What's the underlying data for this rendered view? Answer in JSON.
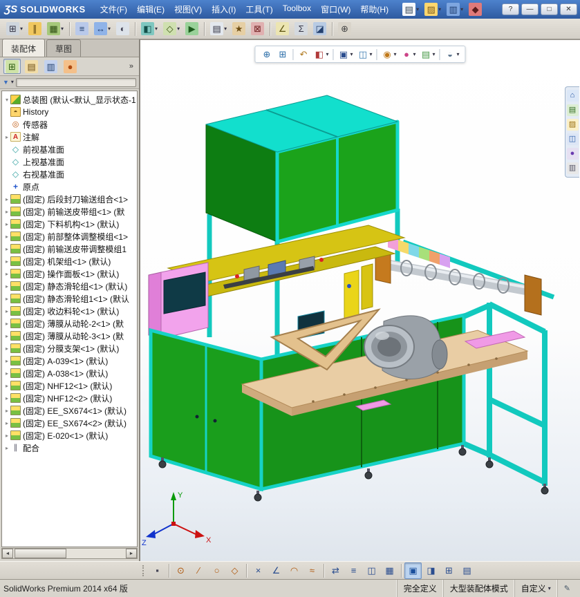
{
  "glyphs": {
    "caret_down": "▾",
    "caret_right": "▸",
    "scroll_left": "◄",
    "scroll_right": "►"
  },
  "titlebar": {
    "logo_mark": "ƷS",
    "brand": "SOLIDWORKS",
    "menus": [
      {
        "id": "file",
        "label": "文件(F)"
      },
      {
        "id": "edit",
        "label": "编辑(E)"
      },
      {
        "id": "view",
        "label": "视图(V)"
      },
      {
        "id": "insert",
        "label": "插入(I)"
      },
      {
        "id": "tools",
        "label": "工具(T)"
      },
      {
        "id": "toolbox",
        "label": "Toolbox"
      },
      {
        "id": "window",
        "label": "窗口(W)"
      },
      {
        "id": "help",
        "label": "帮助(H)"
      }
    ],
    "quick_icons": [
      {
        "name": "new-document-icon",
        "glyph": "▤",
        "bg": "#f7f9fc",
        "fg": "#345",
        "dd": true
      },
      {
        "name": "open-icon",
        "glyph": "▨",
        "bg": "#ffd76e",
        "fg": "#7a5c1e",
        "dd": true
      },
      {
        "name": "save-icon",
        "glyph": "▥",
        "bg": "#7ea6e0",
        "fg": "#1d3c6e",
        "dd": true
      },
      {
        "name": "rebuild-icon",
        "glyph": "◆",
        "bg": "#e07a7a",
        "fg": "#5c1d1d"
      }
    ],
    "window_buttons": [
      {
        "name": "help-button",
        "glyph": "?"
      },
      {
        "name": "minimize-button",
        "glyph": "—"
      },
      {
        "name": "maximize-button",
        "glyph": "□"
      },
      {
        "name": "close-button",
        "glyph": "✕"
      }
    ]
  },
  "main_toolbar": {
    "buttons": [
      {
        "name": "insert-components-icon",
        "glyph": "⊞",
        "bg": "#cfd6de",
        "fg": "#334",
        "dd": true
      },
      {
        "name": "mate-icon",
        "glyph": "∥",
        "bg": "#f0c75e",
        "fg": "#5a4310"
      },
      {
        "name": "linear-component-pattern-icon",
        "glyph": "▦",
        "bg": "#a6c87a",
        "fg": "#2e4d12",
        "dd": true
      },
      {
        "sep": true
      },
      {
        "name": "smart-fasteners-icon",
        "glyph": "≡",
        "bg": "#b9c9ea",
        "fg": "#23406e"
      },
      {
        "name": "move-component-icon",
        "glyph": "↔",
        "bg": "#8fb3e8",
        "fg": "#1d3c6e",
        "dd": true
      },
      {
        "name": "show-hidden-components-icon",
        "glyph": "◐",
        "bg": "#dde3ea",
        "fg": "#445"
      },
      {
        "sep": true
      },
      {
        "name": "assembly-features-icon",
        "glyph": "◧",
        "bg": "#7fc7c0",
        "fg": "#124f49",
        "dd": true
      },
      {
        "name": "reference-geometry-icon",
        "glyph": "◇",
        "bg": "#cfe0b0",
        "fg": "#39550f",
        "dd": true
      },
      {
        "name": "new-motion-study-icon",
        "glyph": "▶",
        "bg": "#9ad29a",
        "fg": "#1e5c1e"
      },
      {
        "sep": true
      },
      {
        "name": "bill-of-materials-icon",
        "glyph": "▤",
        "bg": "#e3e8ee",
        "fg": "#334",
        "dd": true
      },
      {
        "name": "exploded-view-icon",
        "glyph": "★",
        "bg": "#e6cfa4",
        "fg": "#6e4e14"
      },
      {
        "name": "interference-detection-icon",
        "glyph": "⊠",
        "bg": "#e0b0b0",
        "fg": "#6e1d1d"
      },
      {
        "sep": true
      },
      {
        "name": "measure-icon",
        "glyph": "∠",
        "bg": "#ece5b2",
        "fg": "#5c5210"
      },
      {
        "name": "mass-properties-icon",
        "glyph": "Σ",
        "bg": "#d4d9df",
        "fg": "#334"
      },
      {
        "name": "section-view-icon",
        "glyph": "◪",
        "bg": "#b8cbe4",
        "fg": "#23406e"
      },
      {
        "sep": true
      },
      {
        "name": "options-icon",
        "glyph": "⊕",
        "bg": "#d9d4ca",
        "fg": "#444"
      }
    ]
  },
  "command_tabs": {
    "tabs": [
      {
        "id": "assembly",
        "label": "装配体",
        "active": true
      },
      {
        "id": "sketch",
        "label": "草图",
        "active": false
      }
    ]
  },
  "feature_panel": {
    "chevron": "»",
    "filter_glyph": "▼",
    "manager_tabs": [
      {
        "name": "featuremanager-tree-tab",
        "glyph": "⊞",
        "bg": "#cfe3a8",
        "fg": "#2e5c12",
        "active": true
      },
      {
        "name": "propertymanager-tab",
        "glyph": "▤",
        "bg": "#f2dda8",
        "fg": "#6e4e14"
      },
      {
        "name": "configurationmanager-tab",
        "glyph": "▥",
        "bg": "#c3d2ee",
        "fg": "#23406e"
      },
      {
        "name": "displaymanager-tab",
        "glyph": "●",
        "bg": "#f4c08a",
        "fg": "#b04a10"
      }
    ]
  },
  "feature_tree": {
    "root": {
      "label": "总装图 (默认<默认_显示状态-1"
    },
    "icon_glyphs": {
      "assembly": "",
      "history": "◓",
      "sensors": "◎",
      "annotations": "A",
      "plane": "◇",
      "origin": "+",
      "component": "",
      "mates": "∥"
    },
    "items": [
      {
        "type": "history",
        "icon": "history-folder-icon",
        "label": "History",
        "expandable": false
      },
      {
        "type": "sensors",
        "icon": "sensors-folder-icon",
        "label": "传感器",
        "expandable": false
      },
      {
        "type": "annotations",
        "icon": "annotations-folder-icon",
        "label": "注解",
        "expandable": true
      },
      {
        "type": "plane",
        "icon": "front-plane-icon",
        "label": "前视基准面",
        "expandable": false
      },
      {
        "type": "plane",
        "icon": "top-plane-icon",
        "label": "上视基准面",
        "expandable": false
      },
      {
        "type": "plane",
        "icon": "right-plane-icon",
        "label": "右视基准面",
        "expandable": false
      },
      {
        "type": "origin",
        "icon": "origin-icon",
        "label": "原点",
        "expandable": false
      },
      {
        "type": "component",
        "icon": "component-assembly-icon",
        "label": "(固定) 后段封刀输送组合<1>",
        "expandable": true
      },
      {
        "type": "component",
        "icon": "component-assembly-icon",
        "label": "(固定) 前输送皮带组<1> (默",
        "expandable": true
      },
      {
        "type": "component",
        "icon": "component-assembly-icon",
        "label": "(固定) 下料机构<1> (默认)",
        "expandable": true
      },
      {
        "type": "component",
        "icon": "component-assembly-icon",
        "label": "(固定) 前部整体调整模组<1>",
        "expandable": true
      },
      {
        "type": "component",
        "icon": "component-assembly-icon",
        "label": "(固定) 前输送皮带调整模组1",
        "expandable": true
      },
      {
        "type": "component",
        "icon": "component-assembly-icon",
        "label": "(固定) 机架组<1> (默认)",
        "expandable": true
      },
      {
        "type": "component",
        "icon": "component-assembly-icon",
        "label": "(固定) 操作面板<1> (默认)",
        "expandable": true
      },
      {
        "type": "component",
        "icon": "component-assembly-icon",
        "label": "(固定) 静态滑轮组<1> (默认)",
        "expandable": true
      },
      {
        "type": "component",
        "icon": "component-assembly-icon",
        "label": "(固定) 静态滑轮组1<1> (默认",
        "expandable": true
      },
      {
        "type": "component",
        "icon": "component-assembly-icon",
        "label": "(固定) 收边料轮<1> (默认)",
        "expandable": true
      },
      {
        "type": "component",
        "icon": "component-assembly-icon",
        "label": "(固定) 薄膜从动轮-2<1> (默",
        "expandable": true
      },
      {
        "type": "component",
        "icon": "component-assembly-icon",
        "label": "(固定) 薄膜从动轮-3<1> (默",
        "expandable": true
      },
      {
        "type": "component",
        "icon": "component-assembly-icon",
        "label": "(固定) 分膜支架<1> (默认)",
        "expandable": true
      },
      {
        "type": "component",
        "icon": "component-assembly-icon",
        "label": "(固定) A-039<1> (默认)",
        "expandable": true
      },
      {
        "type": "component",
        "icon": "component-assembly-icon",
        "label": "(固定) A-038<1> (默认)",
        "expandable": true
      },
      {
        "type": "component",
        "icon": "component-assembly-icon",
        "label": "(固定) NHF12<1> (默认)",
        "expandable": true
      },
      {
        "type": "component",
        "icon": "component-assembly-icon",
        "label": "(固定) NHF12<2> (默认)",
        "expandable": true
      },
      {
        "type": "component",
        "icon": "component-assembly-icon",
        "label": "(固定) EE_SX674<1> (默认)",
        "expandable": true
      },
      {
        "type": "component",
        "icon": "component-assembly-icon",
        "label": "(固定) EE_SX674<2> (默认)",
        "expandable": true
      },
      {
        "type": "component",
        "icon": "component-assembly-icon",
        "label": "(固定) E-020<1> (默认)",
        "expandable": true
      },
      {
        "type": "mates",
        "icon": "mates-folder-icon",
        "label": "配合",
        "expandable": true
      }
    ]
  },
  "viewport": {
    "headsup_icons": [
      {
        "name": "zoom-fit-icon",
        "glyph": "⊕",
        "fg": "#2a6da8"
      },
      {
        "name": "zoom-area-icon",
        "glyph": "⊞",
        "fg": "#2a6da8"
      },
      {
        "sep": true
      },
      {
        "name": "previous-view-icon",
        "glyph": "↶",
        "fg": "#b07a20"
      },
      {
        "name": "section-view-icon",
        "glyph": "◧",
        "fg": "#b03a3a",
        "dd": true
      },
      {
        "sep": true
      },
      {
        "name": "view-orientation-icon",
        "glyph": "▣",
        "fg": "#2a4d8f",
        "dd": true
      },
      {
        "name": "display-style-icon",
        "glyph": "◫",
        "fg": "#3a7ab0",
        "dd": true
      },
      {
        "sep": true
      },
      {
        "name": "hide-show-items-icon",
        "glyph": "◉",
        "fg": "#c07818",
        "dd": true
      },
      {
        "name": "edit-appearance-icon",
        "glyph": "●",
        "fg": "#cc4488",
        "dd": true
      },
      {
        "name": "apply-scene-icon",
        "glyph": "▤",
        "fg": "#4a9a4a",
        "dd": true
      },
      {
        "sep": true
      },
      {
        "name": "view-settings-icon",
        "glyph": "◒",
        "fg": "#56708a",
        "dd": true
      }
    ]
  },
  "task_pane": {
    "icons": [
      {
        "name": "solidworks-resources-icon",
        "glyph": "⌂",
        "bg": "#dbe7f7",
        "fg": "#1d4e9e"
      },
      {
        "name": "design-library-icon",
        "glyph": "▤",
        "bg": "#ddeed4",
        "fg": "#2f6b1f"
      },
      {
        "name": "file-explorer-icon",
        "glyph": "▨",
        "bg": "#fbf0c8",
        "fg": "#9a6f12"
      },
      {
        "name": "view-palette-icon",
        "glyph": "◫",
        "bg": "#dde6f6",
        "fg": "#2a5da8"
      },
      {
        "name": "appearances-icon",
        "glyph": "●",
        "bg": "#e6e0f2",
        "fg": "#6a3ab0"
      },
      {
        "name": "custom-properties-icon",
        "glyph": "▥",
        "bg": "#e8e8e8",
        "fg": "#556"
      }
    ]
  },
  "sketch_toolbar": {
    "buttons": [
      {
        "name": "select-cursor-icon",
        "glyph": "▪",
        "fg": "#445"
      },
      {
        "sep": true
      },
      {
        "name": "circle-tool-icon",
        "glyph": "⊙",
        "fg": "#b05a10"
      },
      {
        "name": "line-tool-icon",
        "glyph": "∕",
        "fg": "#b05a10"
      },
      {
        "name": "ellipse-tool-icon",
        "glyph": "○",
        "fg": "#b05a10"
      },
      {
        "name": "polygon-tool-icon",
        "glyph": "◇",
        "fg": "#b05a10"
      },
      {
        "sep": true
      },
      {
        "name": "trim-entities-icon",
        "glyph": "×",
        "fg": "#2a4d8f"
      },
      {
        "name": "smart-dimension-icon",
        "glyph": "∠",
        "fg": "#2a4d8f"
      },
      {
        "name": "arc-tool-icon",
        "glyph": "◠",
        "fg": "#b05a10"
      },
      {
        "name": "spline-tool-icon",
        "glyph": "≈",
        "fg": "#b05a10"
      },
      {
        "sep": true
      },
      {
        "name": "convert-entities-icon",
        "glyph": "⇄",
        "fg": "#2a4d8f"
      },
      {
        "name": "offset-entities-icon",
        "glyph": "≡",
        "fg": "#2a4d8f"
      },
      {
        "name": "mirror-entities-icon",
        "glyph": "◫",
        "fg": "#2a4d8f"
      },
      {
        "name": "linear-sketch-pattern-icon",
        "glyph": "▦",
        "fg": "#2a4d8f"
      },
      {
        "sep": true
      },
      {
        "name": "sketch-icon",
        "glyph": "▣",
        "fg": "#1a4f9c",
        "active": true
      },
      {
        "name": "sketch-plane-icon",
        "glyph": "◨",
        "fg": "#2a4d8f"
      },
      {
        "name": "grid-system-icon",
        "glyph": "⊞",
        "fg": "#2a4d8f"
      },
      {
        "name": "sketch-table-icon",
        "glyph": "▤",
        "fg": "#2a4d8f"
      }
    ]
  },
  "statusbar": {
    "left": "SolidWorks Premium 2014 x64 版",
    "cells": [
      {
        "name": "status-fully-defined",
        "label": "完全定义"
      },
      {
        "name": "status-large-assembly-mode",
        "label": "大型装配体模式"
      },
      {
        "name": "status-custom",
        "label": "自定义",
        "dd": true
      },
      {
        "name": "quick-tips-icon",
        "glyph": "✎"
      }
    ]
  }
}
